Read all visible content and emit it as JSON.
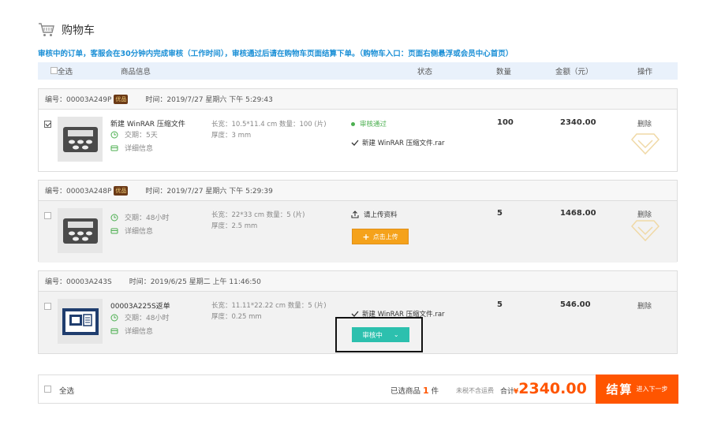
{
  "page": {
    "title": "购物车",
    "notice": "审核中的订单，客服会在30分钟内完成审核（工作时间），审核通过后请在购物车页面结算下单。（购物车入口：页面右侧悬浮或会员中心首页）"
  },
  "header": {
    "select_all": "全选",
    "product": "商品信息",
    "status": "状态",
    "quantity": "数量",
    "amount": "金额（元）",
    "action": "操作"
  },
  "orders": [
    {
      "id": "编号：00003A249P",
      "badge": "优品",
      "time": "时间：2019/7/27 星期六 下午 5:29:43",
      "name": "新建 WinRAR 压缩文件",
      "delivery": "交期：5天",
      "details": "详细信息",
      "spec1": "长宽：10.5*11.4 cm  数量：100 (片)",
      "spec2": "厚度：3 mm",
      "status": "审核通过",
      "file": "新建 WinRAR 压缩文件.rar",
      "qty": "100",
      "amount": "2340.00",
      "delete": "删除"
    },
    {
      "id": "编号：00003A248P",
      "badge": "优品",
      "time": "时间：2019/7/27 星期六 下午 5:29:39",
      "delivery": "交期：48小时",
      "details": "详细信息",
      "spec1": "长宽：22*33 cm  数量：5 (片)",
      "spec2": "厚度：2.5 mm",
      "status": "请上传资料",
      "upload": "点击上传",
      "qty": "5",
      "amount": "1468.00",
      "delete": "删除"
    },
    {
      "id": "编号：00003A243S",
      "time": "时间：2019/6/25 星期二 上午 11:46:50",
      "name": "00003A225S返单",
      "delivery": "交期：48小时",
      "details": "详细信息",
      "spec1": "长宽：11.11*22.22 cm  数量：5 (片)",
      "spec2": "厚度：0.25 mm",
      "file": "新建 WinRAR 压缩文件.rar",
      "review": "审核中",
      "qty": "5",
      "amount": "546.00",
      "delete": "删除"
    }
  ],
  "footer": {
    "select_all": "全选",
    "selected_prefix": "已选商品",
    "selected_count": "1",
    "selected_unit": "件",
    "no_fee": "未税不含运费",
    "total_label": "合计",
    "currency": "¥",
    "total": "2340.00",
    "checkout": "结算",
    "checkout_sub": "进入下一步"
  },
  "colors": {
    "accent": "#ff5500",
    "notice": "#1a8fd6",
    "review": "#2cc0ae",
    "upload": "#f5a21b",
    "approved": "#4caf50"
  }
}
